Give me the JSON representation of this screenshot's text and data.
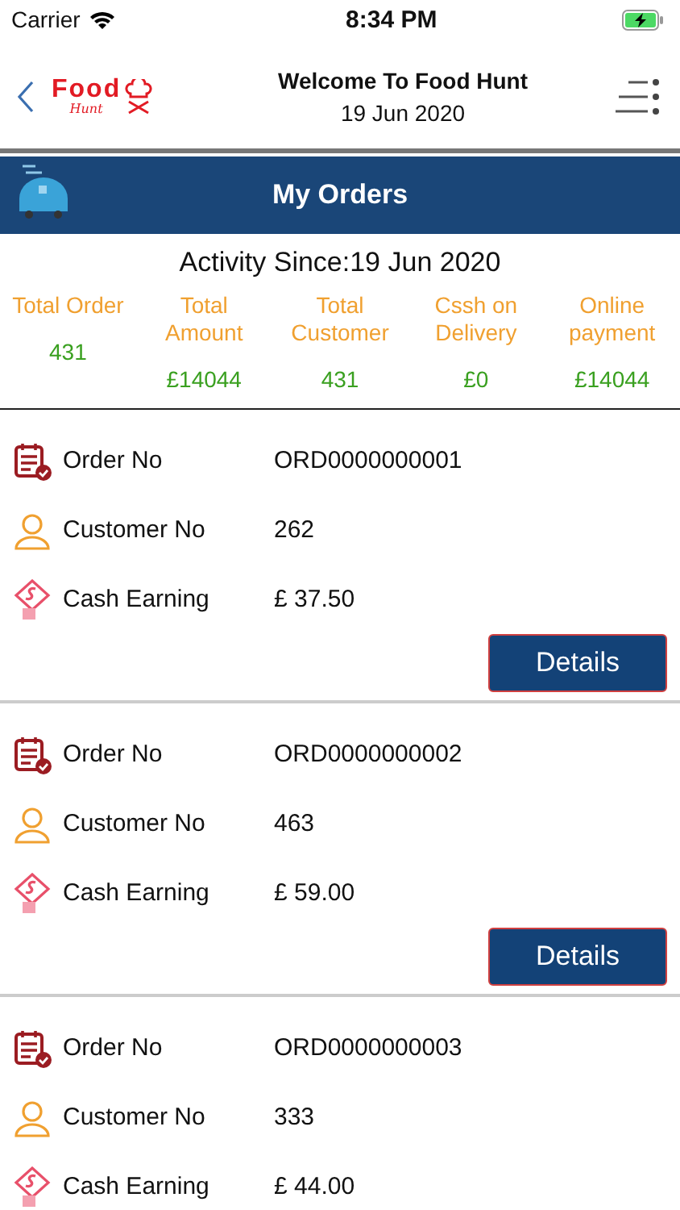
{
  "status_bar": {
    "carrier": "Carrier",
    "time": "8:34 PM"
  },
  "header": {
    "logo_word": "Food",
    "logo_sub": "Hunt",
    "title": "Welcome To Food Hunt",
    "date": "19 Jun 2020"
  },
  "banner": {
    "title": "My Orders"
  },
  "activity": {
    "title": "Activity Since:19 Jun 2020",
    "stats": [
      {
        "label": "Total Order",
        "value": "431"
      },
      {
        "label": "Total Amount",
        "value": "£14044"
      },
      {
        "label": "Total Customer",
        "value": "431"
      },
      {
        "label": "Cssh on Delivery",
        "value": "£0"
      },
      {
        "label": "Online payment",
        "value": "£14044"
      }
    ]
  },
  "orders": [
    {
      "fields": [
        {
          "kind": "order",
          "label": "Order No",
          "value": "ORD0000000001"
        },
        {
          "kind": "customer",
          "label": "Customer No",
          "value": "262"
        },
        {
          "kind": "cash",
          "label": "Cash Earning",
          "value": "£ 37.50"
        }
      ],
      "button": "Details"
    },
    {
      "fields": [
        {
          "kind": "order",
          "label": "Order No",
          "value": "ORD0000000002"
        },
        {
          "kind": "customer",
          "label": "Customer No",
          "value": "463"
        },
        {
          "kind": "cash",
          "label": "Cash Earning",
          "value": "£ 59.00"
        }
      ],
      "button": "Details"
    },
    {
      "fields": [
        {
          "kind": "order",
          "label": "Order No",
          "value": "ORD0000000003"
        },
        {
          "kind": "customer",
          "label": "Customer No",
          "value": "333"
        },
        {
          "kind": "cash",
          "label": "Cash Earning",
          "value": "£ 44.00"
        }
      ]
    }
  ]
}
